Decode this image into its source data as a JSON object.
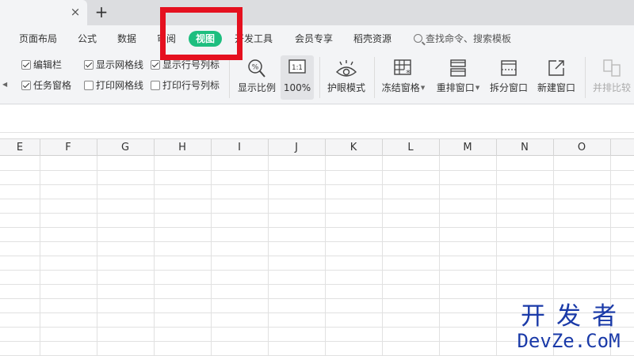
{
  "tab_strip": {
    "close_glyph": "×",
    "add_glyph": "+"
  },
  "menu": {
    "items": [
      "页面布局",
      "公式",
      "数据",
      "审阅",
      "视图",
      "开发工具",
      "会员专享",
      "稻壳资源"
    ],
    "active": "视图",
    "search_placeholder": "查找命令、搜索模板"
  },
  "ribbon": {
    "checkboxes": [
      {
        "label": "编辑栏",
        "checked": true
      },
      {
        "label": "任务窗格",
        "checked": true
      },
      {
        "label": "显示网格线",
        "checked": true
      },
      {
        "label": "打印网格线",
        "checked": false
      },
      {
        "label": "显示行号列标",
        "checked": true
      },
      {
        "label": "打印行号列标",
        "checked": false
      }
    ],
    "buttons": {
      "zoom": "显示比例",
      "zoom_100": "100%",
      "zoom_100_icon": "1:1",
      "eye_care": "护眼模式",
      "freeze": "冻结窗格",
      "arrange": "重排窗口",
      "split": "拆分窗口",
      "new_window": "新建窗口",
      "side_by_side": "并排比较"
    }
  },
  "columns": [
    "E",
    "F",
    "G",
    "H",
    "I",
    "J",
    "K",
    "L",
    "M",
    "N",
    "O"
  ],
  "watermark": {
    "cn": "开发者",
    "en": "DevZe.CoM"
  },
  "colors": {
    "active_tab": "#1ebe7f",
    "highlight_box": "#e5101f",
    "watermark": "#1a3aa8"
  }
}
